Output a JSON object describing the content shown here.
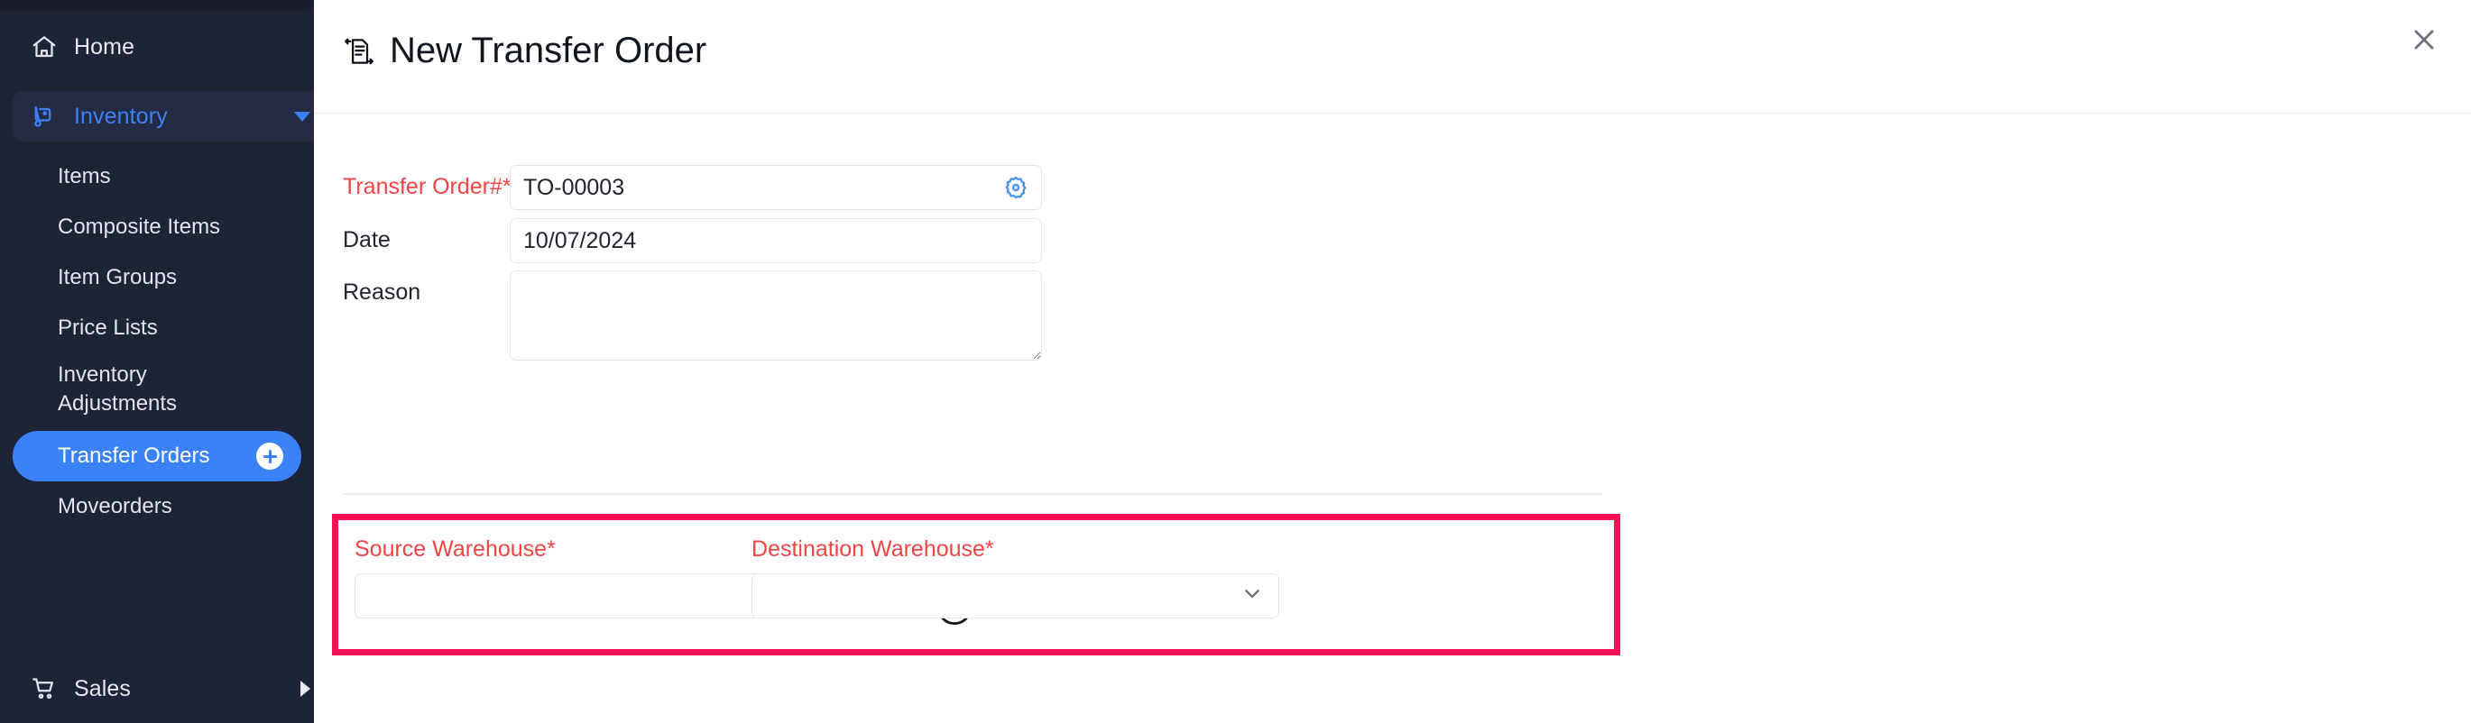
{
  "sidebar": {
    "items": [
      {
        "label": "Home",
        "icon": "home-icon"
      },
      {
        "label": "Inventory",
        "icon": "dolly-icon",
        "caret": "chevron-down-icon"
      },
      {
        "label": "Sales",
        "icon": "shopping-cart-icon",
        "caret": "chevron-right-icon"
      }
    ],
    "inventory_submenu": [
      {
        "label": "Items"
      },
      {
        "label": "Composite Items"
      },
      {
        "label": "Item Groups"
      },
      {
        "label": "Price Lists"
      },
      {
        "label": "Inventory Adjustments"
      },
      {
        "label": "Transfer Orders",
        "selected": true,
        "badge": "add-icon"
      },
      {
        "label": "Moveorders"
      }
    ],
    "colors": {
      "background": "#1e2338",
      "accent": "#3b82f6",
      "active_item_bg": "#252b44",
      "selected_bg": "#3b82f6"
    }
  },
  "header": {
    "title": "New Transfer Order",
    "title_icon": "transfer-document-icon",
    "close_icon": "close-icon"
  },
  "form": {
    "fields": [
      {
        "label": "Transfer Order#*",
        "required": true,
        "value": "TO-00003",
        "placeholder": "",
        "action_icon": "gear-icon"
      },
      {
        "label": "Date",
        "required": false,
        "value": "10/07/2024",
        "placeholder": ""
      },
      {
        "label": "Reason",
        "required": false,
        "value": "",
        "placeholder": ""
      }
    ]
  },
  "warehouse_section": {
    "highlighted": true,
    "highlight_color": "#f90f52",
    "source": {
      "label": "Source Warehouse*",
      "value": "",
      "placeholder": "",
      "chevron": "chevron-down-icon"
    },
    "destination": {
      "label": "Destination Warehouse*",
      "value": "",
      "placeholder": "",
      "chevron": "chevron-down-icon"
    },
    "swap_icon": "swap-arrows-icon"
  }
}
